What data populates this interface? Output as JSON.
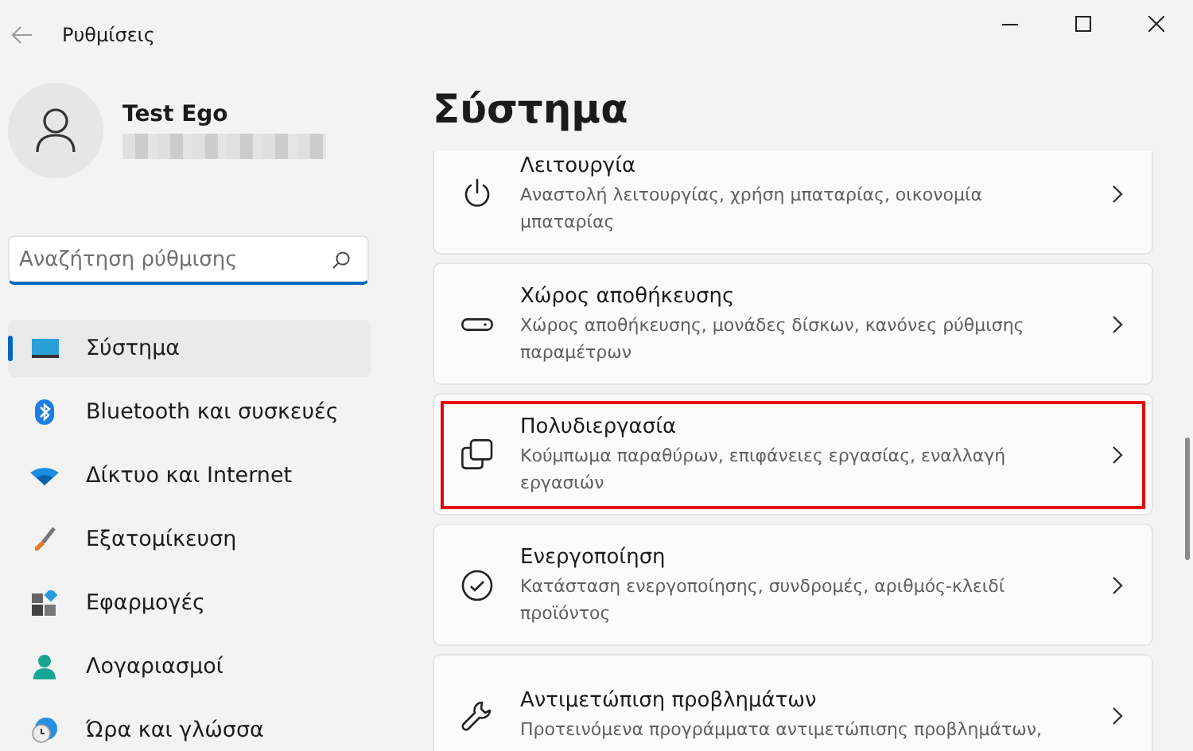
{
  "window": {
    "title": "Ρυθμίσεις"
  },
  "profile": {
    "name": "Test Ego"
  },
  "search": {
    "placeholder": "Αναζήτηση ρύθμισης"
  },
  "sidebar": {
    "items": [
      {
        "label": "Σύστημα",
        "selected": true
      },
      {
        "label": "Bluetooth και συσκευές",
        "selected": false
      },
      {
        "label": "Δίκτυο και Internet",
        "selected": false
      },
      {
        "label": "Εξατομίκευση",
        "selected": false
      },
      {
        "label": "Εφαρμογές",
        "selected": false
      },
      {
        "label": "Λογαριασμοί",
        "selected": false
      },
      {
        "label": "Ώρα και γλώσσα",
        "selected": false
      }
    ]
  },
  "page": {
    "title": "Σύστημα",
    "cards": [
      {
        "title": "Λειτουργία",
        "description": "Αναστολή λειτουργίας, χρήση μπαταρίας, οικονομία μπαταρίας",
        "highlighted": false
      },
      {
        "title": "Χώρος αποθήκευσης",
        "description": "Χώρος αποθήκευσης, μονάδες δίσκων, κανόνες ρύθμισης παραμέτρων",
        "highlighted": false
      },
      {
        "title": "Πολυδιεργασία",
        "description": "Κούμπωμα παραθύρων, επιφάνειες εργασίας, εναλλαγή εργασιών",
        "highlighted": true
      },
      {
        "title": "Ενεργοποίηση",
        "description": "Κατάσταση ενεργοποίησης, συνδρομές, αριθμός-κλειδί προϊόντος",
        "highlighted": false
      },
      {
        "title": "Αντιμετώπιση προβλημάτων",
        "description": "Προτεινόμενα προγράμματα αντιμετώπισης προβλημάτων,",
        "highlighted": false
      }
    ]
  }
}
